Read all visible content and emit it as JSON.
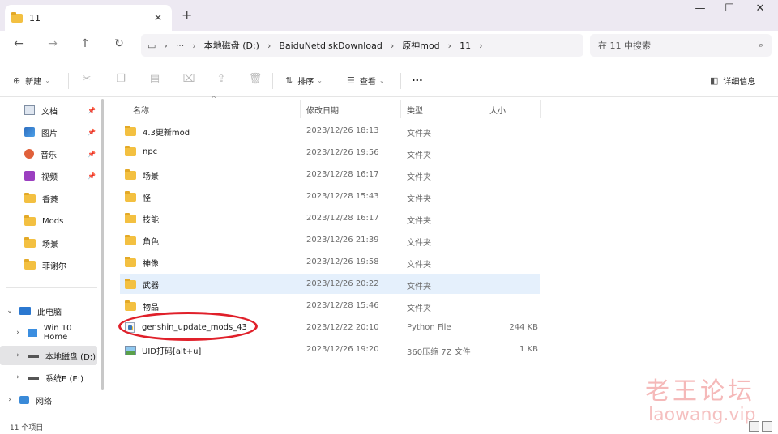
{
  "tab": {
    "title": "11"
  },
  "address": {
    "segments": [
      "本地磁盘 (D:)",
      "BaiduNetdiskDownload",
      "原神mod",
      "11"
    ]
  },
  "search": {
    "placeholder": "在 11 中搜索"
  },
  "toolbar": {
    "new_label": "新建",
    "sort_label": "排序",
    "view_label": "查看",
    "more_label": "···",
    "details_label": "详细信息"
  },
  "sidebar": {
    "quick_access": [
      {
        "label": "文档",
        "icon": "document-icon",
        "pinned": true
      },
      {
        "label": "图片",
        "icon": "pictures-icon",
        "pinned": true
      },
      {
        "label": "音乐",
        "icon": "music-icon",
        "pinned": true
      },
      {
        "label": "视频",
        "icon": "videos-icon",
        "pinned": true
      },
      {
        "label": "香菱",
        "icon": "folder-icon",
        "pinned": false
      },
      {
        "label": "Mods",
        "icon": "folder-icon",
        "pinned": false
      },
      {
        "label": "场景",
        "icon": "folder-icon",
        "pinned": false
      },
      {
        "label": "菲谢尔",
        "icon": "folder-icon",
        "pinned": false
      }
    ],
    "this_pc": "此电脑",
    "drives": [
      {
        "label": "Win 10 Home",
        "icon": "windows-drive-icon"
      },
      {
        "label": "本地磁盘 (D:)",
        "icon": "drive-icon",
        "selected": true
      },
      {
        "label": "系统E (E:)",
        "icon": "drive-icon"
      }
    ],
    "network": "网络"
  },
  "columns": {
    "name": "名称",
    "date": "修改日期",
    "type": "类型",
    "size": "大小"
  },
  "files": [
    {
      "name": "4.3更新mod",
      "date": "2023/12/26 18:13",
      "type": "文件夹",
      "size": "",
      "icon": "folder-icon"
    },
    {
      "name": "npc",
      "date": "2023/12/26 19:56",
      "type": "文件夹",
      "size": "",
      "icon": "folder-icon"
    },
    {
      "name": "场景",
      "date": "2023/12/28 16:17",
      "type": "文件夹",
      "size": "",
      "icon": "folder-icon"
    },
    {
      "name": "怪",
      "date": "2023/12/28 15:43",
      "type": "文件夹",
      "size": "",
      "icon": "folder-icon"
    },
    {
      "name": "技能",
      "date": "2023/12/28 16:17",
      "type": "文件夹",
      "size": "",
      "icon": "folder-icon"
    },
    {
      "name": "角色",
      "date": "2023/12/26 21:39",
      "type": "文件夹",
      "size": "",
      "icon": "folder-icon"
    },
    {
      "name": "神像",
      "date": "2023/12/26 19:58",
      "type": "文件夹",
      "size": "",
      "icon": "folder-icon"
    },
    {
      "name": "武器",
      "date": "2023/12/26 20:22",
      "type": "文件夹",
      "size": "",
      "icon": "folder-icon",
      "highlight": true
    },
    {
      "name": "物品",
      "date": "2023/12/28 15:46",
      "type": "文件夹",
      "size": "",
      "icon": "folder-icon"
    },
    {
      "name": "genshin_update_mods_43",
      "date": "2023/12/22 20:10",
      "type": "Python File",
      "size": "244 KB",
      "icon": "python-file-icon",
      "circled": true
    },
    {
      "name": "UID打码[alt+u]",
      "date": "2023/12/26 19:20",
      "type": "360压缩 7Z 文件",
      "size": "1 KB",
      "icon": "archive-image-icon"
    }
  ],
  "status": {
    "count": "11 个项目"
  },
  "watermark": {
    "cn": "老王论坛",
    "en": "laowang.vip"
  },
  "colors": {
    "folder": "#f3c041",
    "highlight_row": "#e5f0fc",
    "annotation": "#e0202a",
    "watermark": "#ec8080"
  }
}
